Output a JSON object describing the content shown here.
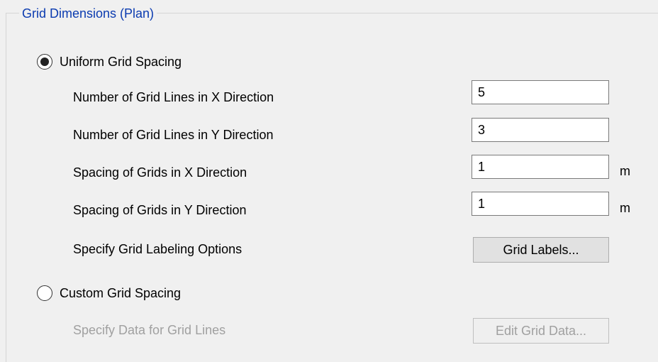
{
  "group": {
    "title": "Grid Dimensions (Plan)"
  },
  "uniform": {
    "radio_label": "Uniform Grid Spacing",
    "selected": true,
    "fields": [
      {
        "label": "Number of Grid Lines in X Direction",
        "value": "5",
        "unit": ""
      },
      {
        "label": "Number of Grid Lines in Y Direction",
        "value": "3",
        "unit": ""
      },
      {
        "label": "Spacing of Grids in X Direction",
        "value": "1",
        "unit": "m"
      },
      {
        "label": "Spacing of Grids in Y Direction",
        "value": "1",
        "unit": "m"
      }
    ],
    "labeling_label": "Specify Grid Labeling Options",
    "labeling_button": "Grid Labels..."
  },
  "custom": {
    "radio_label": "Custom Grid Spacing",
    "selected": false,
    "data_label": "Specify Data for Grid Lines",
    "data_button": "Edit Grid Data..."
  },
  "colors": {
    "group_title": "#0b3bb0",
    "disabled_text": "#a0a0a0",
    "background": "#f0f0f0"
  }
}
